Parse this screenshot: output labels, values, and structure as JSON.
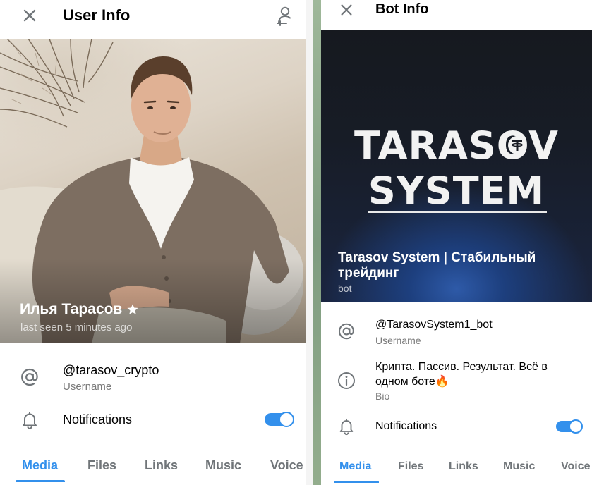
{
  "user_panel": {
    "title": "User Info",
    "name": "Илья Тарасов",
    "status": "last seen 5 minutes ago",
    "username": "@tarasov_crypto",
    "username_label": "Username",
    "notifications_label": "Notifications",
    "notifications_on": true,
    "tabs": [
      {
        "label": "Media",
        "active": true
      },
      {
        "label": "Files",
        "active": false
      },
      {
        "label": "Links",
        "active": false
      },
      {
        "label": "Music",
        "active": false
      },
      {
        "label": "Voice",
        "active": false
      }
    ]
  },
  "bot_panel": {
    "title": "Bot Info",
    "logo_line1": "TARASOV",
    "logo_line2": "SYSTEM",
    "name": "Tarasov System | Стабильный трейдинг",
    "type": "bot",
    "username": "@TarasovSystem1_bot",
    "username_label": "Username",
    "bio": "Крипта. Пассив. Результат. Всё в одном боте🔥",
    "bio_label": "Bio",
    "notifications_label": "Notifications",
    "notifications_on": true,
    "tabs": [
      {
        "label": "Media",
        "active": true
      },
      {
        "label": "Files",
        "active": false
      },
      {
        "label": "Links",
        "active": false
      },
      {
        "label": "Music",
        "active": false
      },
      {
        "label": "Voice",
        "active": false
      }
    ]
  },
  "colors": {
    "accent": "#3390ec",
    "secondary_text": "#7a7a7a",
    "icon_gray": "#707579"
  },
  "icons": {
    "close": "close-icon",
    "add_contact": "add-contact-icon",
    "username": "at-sign-icon",
    "bio": "info-icon",
    "notifications": "bell-icon",
    "verified_star": "star-icon"
  }
}
